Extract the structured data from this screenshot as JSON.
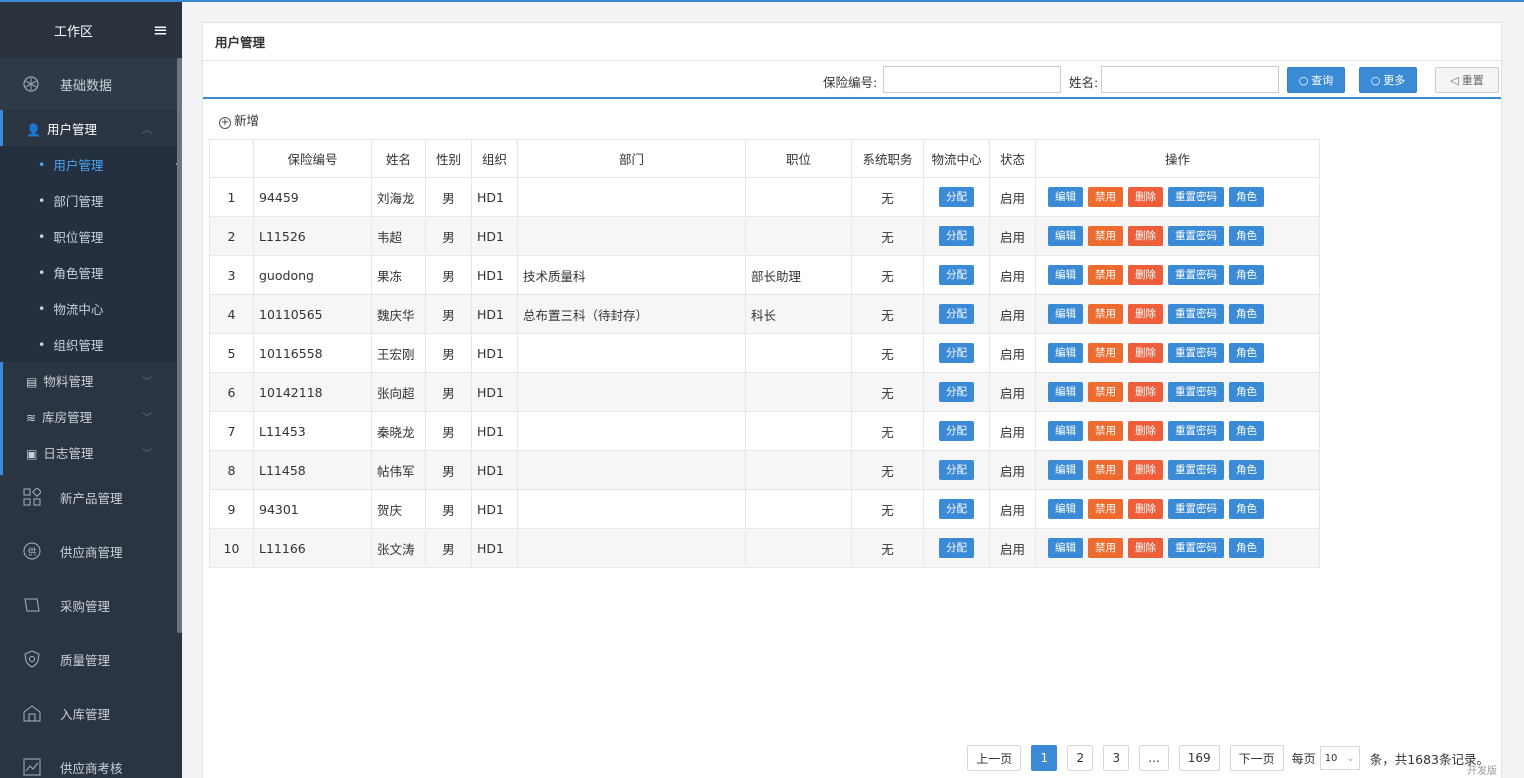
{
  "sidebar": {
    "header_title": "工作区",
    "top_item": "基础数据",
    "groups": [
      {
        "label": "用户管理"
      },
      {
        "label": "物料管理"
      },
      {
        "label": "库房管理"
      },
      {
        "label": "日志管理"
      }
    ],
    "subitems": [
      "用户管理",
      "部门管理",
      "职位管理",
      "角色管理",
      "物流中心",
      "组织管理"
    ],
    "main_items": [
      "新产品管理",
      "供应商管理",
      "采购管理",
      "质量管理",
      "入库管理",
      "供应商考核"
    ]
  },
  "panel": {
    "title": "用户管理",
    "search": {
      "insurance_label": "保险编号:",
      "insurance_value": "",
      "name_label": "姓名:",
      "name_value": "",
      "query_btn": "查询",
      "more_btn": "更多",
      "reset_btn": "重置"
    },
    "add_label": "新增"
  },
  "table": {
    "headers": [
      "",
      "保险编号",
      "姓名",
      "性别",
      "组织",
      "部门",
      "职位",
      "系统职务",
      "物流中心",
      "状态",
      "操作"
    ],
    "rows": [
      {
        "no": "1",
        "code": "94459",
        "name": "刘海龙",
        "sex": "男",
        "org": "HD1",
        "dept": "",
        "pos": "",
        "duty": "无",
        "status": "启用"
      },
      {
        "no": "2",
        "code": "L11526",
        "name": "韦超",
        "sex": "男",
        "org": "HD1",
        "dept": "",
        "pos": "",
        "duty": "无",
        "status": "启用"
      },
      {
        "no": "3",
        "code": "guodong",
        "name": "果冻",
        "sex": "男",
        "org": "HD1",
        "dept": "技术质量科",
        "pos": "部长助理",
        "duty": "无",
        "status": "启用"
      },
      {
        "no": "4",
        "code": "10110565",
        "name": "魏庆华",
        "sex": "男",
        "org": "HD1",
        "dept": "总布置三科（待封存）",
        "pos": "科长",
        "duty": "无",
        "status": "启用"
      },
      {
        "no": "5",
        "code": "10116558",
        "name": "王宏刚",
        "sex": "男",
        "org": "HD1",
        "dept": "",
        "pos": "",
        "duty": "无",
        "status": "启用"
      },
      {
        "no": "6",
        "code": "10142118",
        "name": "张向超",
        "sex": "男",
        "org": "HD1",
        "dept": "",
        "pos": "",
        "duty": "无",
        "status": "启用"
      },
      {
        "no": "7",
        "code": "L11453",
        "name": "秦晓龙",
        "sex": "男",
        "org": "HD1",
        "dept": "",
        "pos": "",
        "duty": "无",
        "status": "启用"
      },
      {
        "no": "8",
        "code": "L11458",
        "name": "帖伟军",
        "sex": "男",
        "org": "HD1",
        "dept": "",
        "pos": "",
        "duty": "无",
        "status": "启用"
      },
      {
        "no": "9",
        "code": "94301",
        "name": "贺庆",
        "sex": "男",
        "org": "HD1",
        "dept": "",
        "pos": "",
        "duty": "无",
        "status": "启用"
      },
      {
        "no": "10",
        "code": "L11166",
        "name": "张文涛",
        "sex": "男",
        "org": "HD1",
        "dept": "",
        "pos": "",
        "duty": "无",
        "status": "启用"
      }
    ],
    "assign_label": "分配",
    "actions": [
      "编辑",
      "禁用",
      "删除",
      "重置密码",
      "角色"
    ]
  },
  "pager": {
    "prev": "上一页",
    "pages": [
      "1",
      "2",
      "3",
      "...",
      "169"
    ],
    "current": "1",
    "next": "下一页",
    "per_page_label": "每页",
    "per_page_value": "10",
    "total_text": "条，共1683条记录。",
    "env_badge": "开发版"
  },
  "colors": {
    "accent": "#3b8ad6",
    "orange": "#ee6b2f",
    "red": "#ef5e3a",
    "sidebar_bg": "#2b3542"
  }
}
